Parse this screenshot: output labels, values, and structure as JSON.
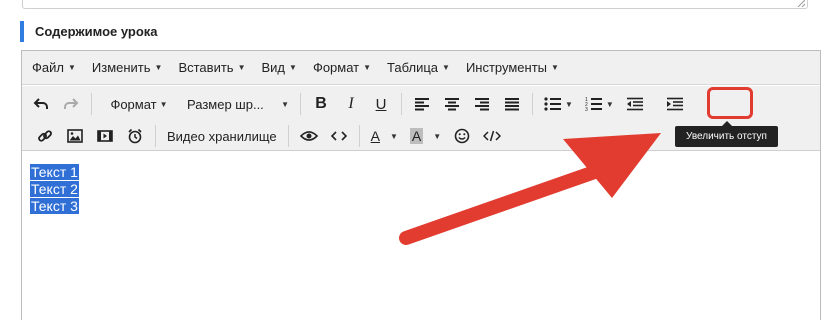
{
  "section": {
    "title": "Содержимое урока",
    "accent_color": "#2f7de1"
  },
  "menubar": {
    "items": [
      {
        "label": "Файл"
      },
      {
        "label": "Изменить"
      },
      {
        "label": "Вставить"
      },
      {
        "label": "Вид"
      },
      {
        "label": "Формат"
      },
      {
        "label": "Таблица"
      },
      {
        "label": "Инструменты"
      }
    ]
  },
  "toolbar": {
    "format_dropdown": "Формат",
    "font_size_dropdown": "Размер шр...",
    "bold_label": "B",
    "italic_label": "I",
    "underline_label": "U",
    "video_storage": "Видео хранилище",
    "text_color_label": "A",
    "bg_color_label": "A",
    "icons": [
      "undo-icon",
      "redo-icon",
      "align-left-icon",
      "align-center-icon",
      "align-right-icon",
      "align-justify-icon",
      "bullet-list-icon",
      "numbered-list-icon",
      "outdent-icon",
      "indent-icon",
      "link-icon",
      "image-icon",
      "media-icon",
      "alarm-clock-icon",
      "eye-icon",
      "code-icon",
      "emoji-icon",
      "source-code-icon"
    ]
  },
  "tooltip": {
    "text": "Увеличить отступ"
  },
  "content": {
    "lines": [
      "Текст 1",
      "Текст 2",
      "Текст 3"
    ],
    "selection_color": "#2f6fd6"
  },
  "annotation": {
    "color": "#e23b2f"
  }
}
